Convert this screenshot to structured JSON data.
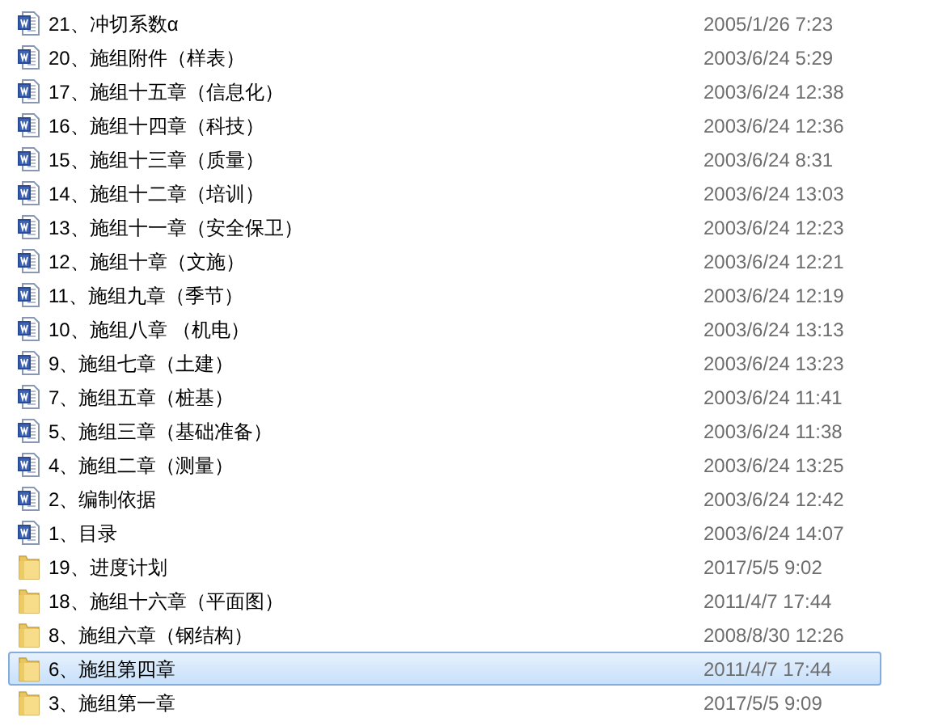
{
  "files": [
    {
      "name": "21、冲切系数α",
      "date": "2005/1/26 7:23",
      "kind": "doc",
      "selected": false
    },
    {
      "name": "20、施组附件（样表）",
      "date": "2003/6/24 5:29",
      "kind": "doc",
      "selected": false
    },
    {
      "name": "17、施组十五章（信息化）",
      "date": "2003/6/24 12:38",
      "kind": "doc",
      "selected": false
    },
    {
      "name": "16、施组十四章（科技）",
      "date": "2003/6/24 12:36",
      "kind": "doc",
      "selected": false
    },
    {
      "name": "15、施组十三章（质量）",
      "date": "2003/6/24 8:31",
      "kind": "doc",
      "selected": false
    },
    {
      "name": "14、施组十二章（培训）",
      "date": "2003/6/24 13:03",
      "kind": "doc",
      "selected": false
    },
    {
      "name": "13、施组十一章（安全保卫）",
      "date": "2003/6/24 12:23",
      "kind": "doc",
      "selected": false
    },
    {
      "name": "12、施组十章（文施）",
      "date": "2003/6/24 12:21",
      "kind": "doc",
      "selected": false
    },
    {
      "name": "11、施组九章（季节）",
      "date": "2003/6/24 12:19",
      "kind": "doc",
      "selected": false
    },
    {
      "name": "10、施组八章 （机电）",
      "date": "2003/6/24 13:13",
      "kind": "doc",
      "selected": false
    },
    {
      "name": "9、施组七章（土建）",
      "date": "2003/6/24 13:23",
      "kind": "doc",
      "selected": false
    },
    {
      "name": "7、施组五章（桩基）",
      "date": "2003/6/24 11:41",
      "kind": "doc",
      "selected": false
    },
    {
      "name": "5、施组三章（基础准备）",
      "date": "2003/6/24 11:38",
      "kind": "doc",
      "selected": false
    },
    {
      "name": "4、施组二章（测量）",
      "date": "2003/6/24 13:25",
      "kind": "doc",
      "selected": false
    },
    {
      "name": "2、编制依据",
      "date": "2003/6/24 12:42",
      "kind": "doc",
      "selected": false
    },
    {
      "name": "1、目录",
      "date": "2003/6/24 14:07",
      "kind": "doc",
      "selected": false
    },
    {
      "name": "19、进度计划",
      "date": "2017/5/5 9:02",
      "kind": "folder",
      "selected": false
    },
    {
      "name": "18、施组十六章（平面图）",
      "date": "2011/4/7 17:44",
      "kind": "folder",
      "selected": false
    },
    {
      "name": "8、施组六章（钢结构）",
      "date": "2008/8/30 12:26",
      "kind": "folder",
      "selected": false
    },
    {
      "name": "6、施组第四章",
      "date": "2011/4/7 17:44",
      "kind": "folder",
      "selected": true
    },
    {
      "name": "3、施组第一章",
      "date": "2017/5/5 9:09",
      "kind": "folder",
      "selected": false
    }
  ]
}
